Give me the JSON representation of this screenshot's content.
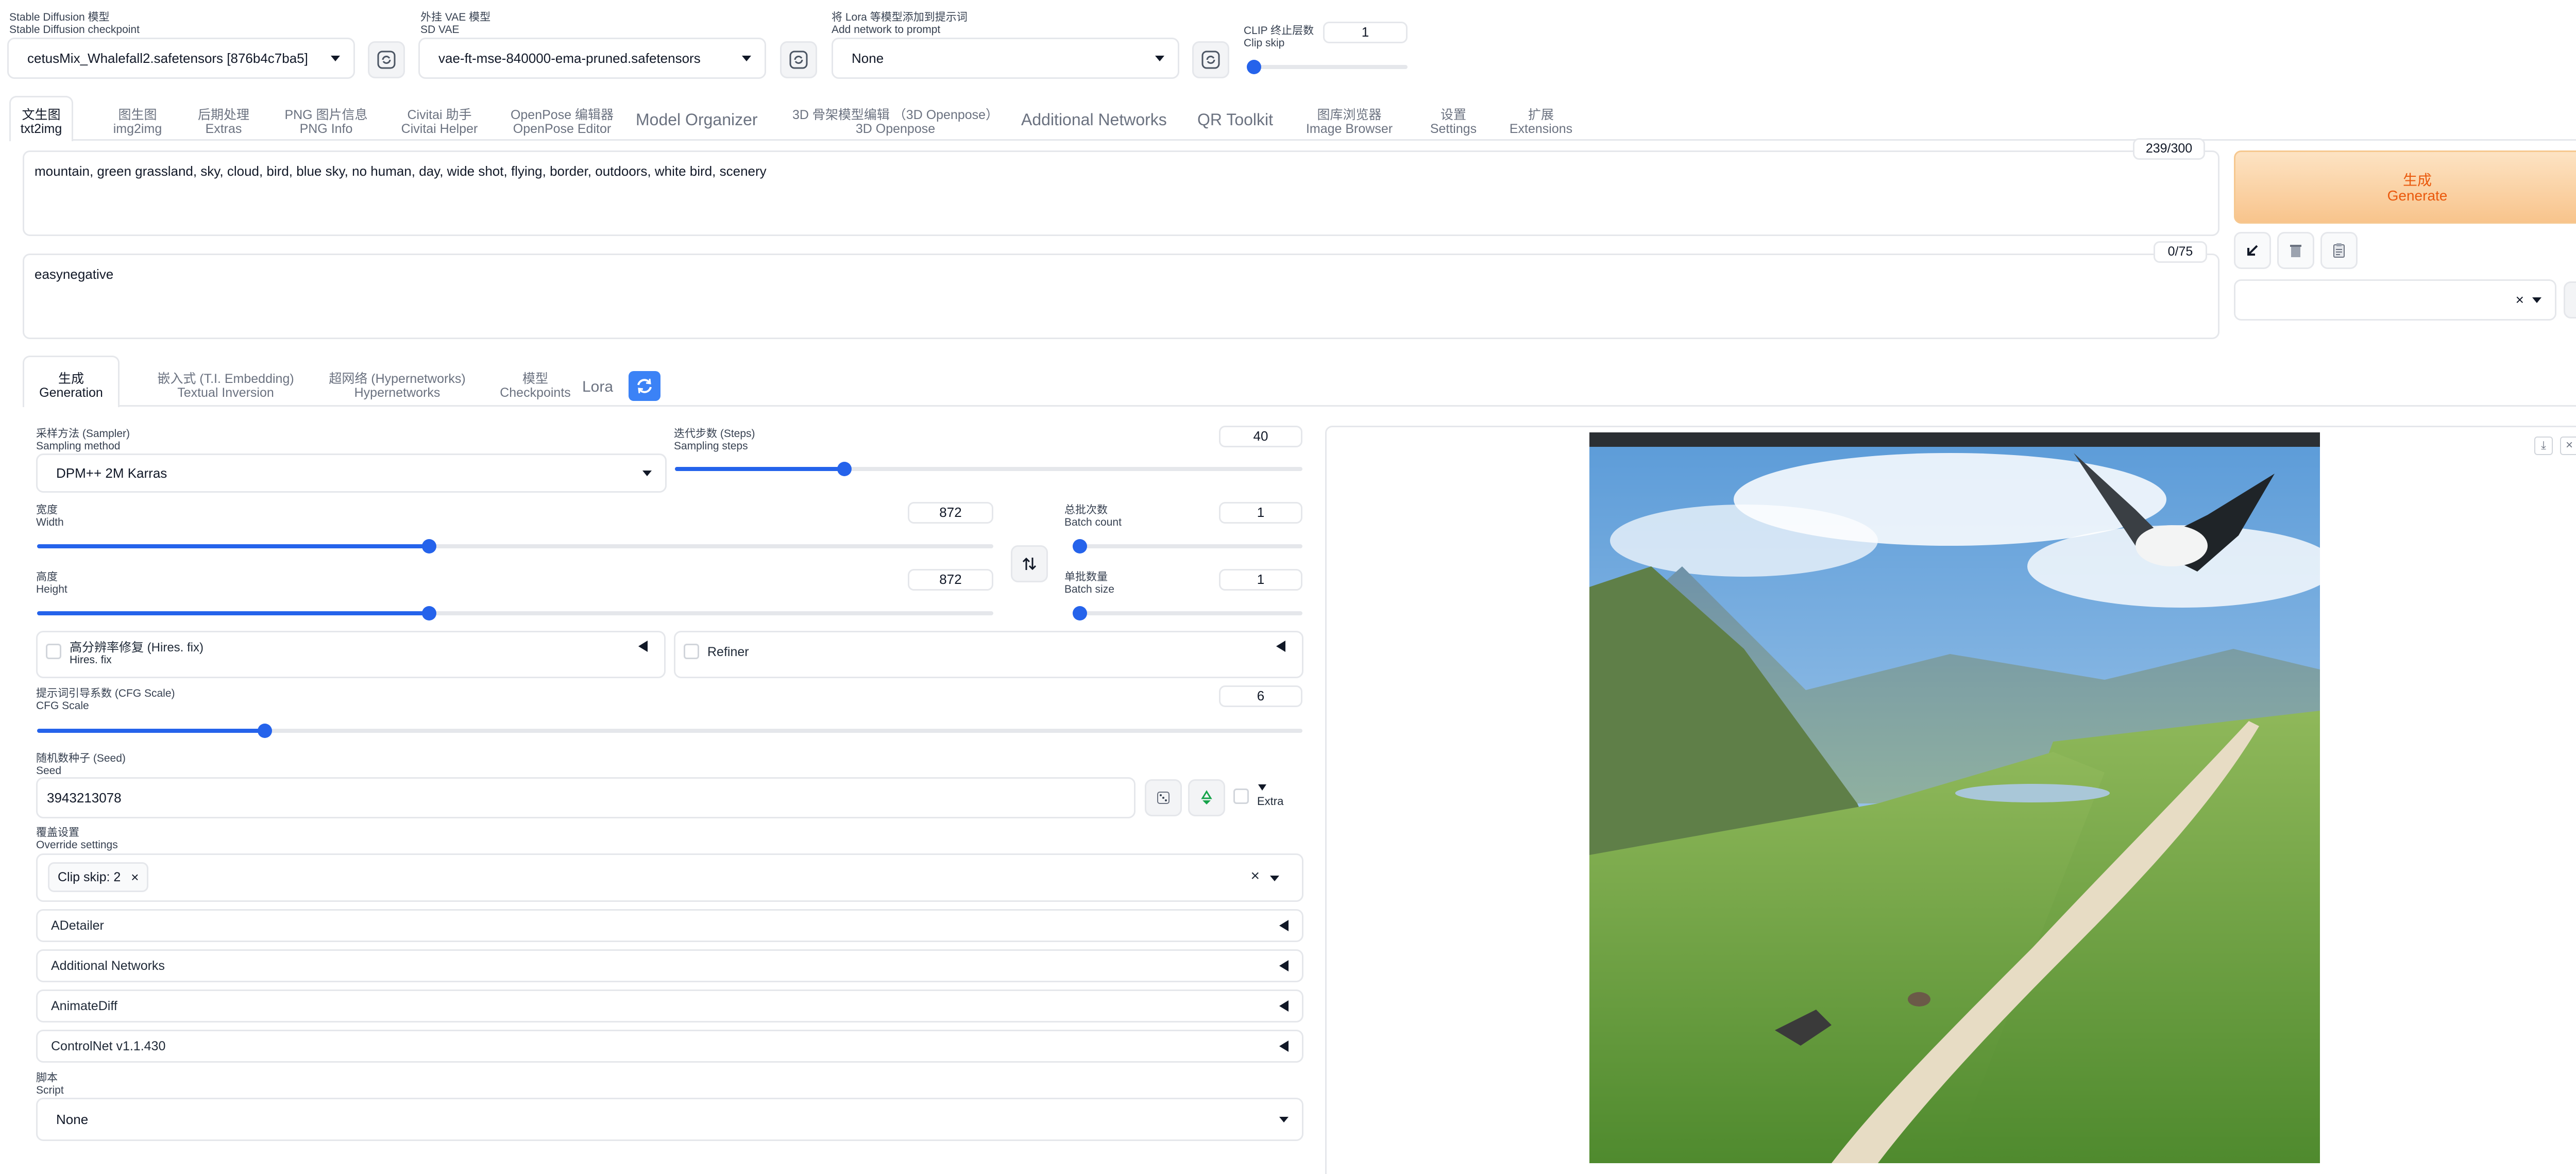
{
  "top": {
    "checkpoint": {
      "label_cn": "Stable Diffusion 模型",
      "label_en": "Stable Diffusion checkpoint",
      "value": "cetusMix_Whalefall2.safetensors [876b4c7ba5]"
    },
    "vae": {
      "label_cn": "外挂 VAE 模型",
      "label_en": "SD VAE",
      "value": "vae-ft-mse-840000-ema-pruned.safetensors"
    },
    "lora": {
      "label_cn": "将 Lora 等模型添加到提示词",
      "label_en": "Add network to prompt",
      "value": "None"
    },
    "clip": {
      "label_cn": "CLIP 终止层数",
      "label_en": "Clip skip",
      "value": "1",
      "fraction": 0
    }
  },
  "tabs": [
    {
      "cn": "文生图",
      "en": "txt2img"
    },
    {
      "cn": "图生图",
      "en": "img2img"
    },
    {
      "cn": "后期处理",
      "en": "Extras"
    },
    {
      "cn": "PNG 图片信息",
      "en": "PNG Info"
    },
    {
      "cn": "Civitai 助手",
      "en": "Civitai Helper"
    },
    {
      "cn": "OpenPose 编辑器",
      "en": "OpenPose Editor"
    },
    {
      "cn": "Model Organizer",
      "en": ""
    },
    {
      "cn": "3D 骨架模型编辑 （3D Openpose）",
      "en": "3D Openpose"
    },
    {
      "cn": "Additional Networks",
      "en": ""
    },
    {
      "cn": "QR Toolkit",
      "en": ""
    },
    {
      "cn": "图库浏览器",
      "en": "Image Browser"
    },
    {
      "cn": "设置",
      "en": "Settings"
    },
    {
      "cn": "扩展",
      "en": "Extensions"
    }
  ],
  "prompt": {
    "text": "mountain, green grassland, sky, cloud, bird, blue sky, no human, day, wide shot, flying, border, outdoors, white bird, scenery",
    "counter": "239/300"
  },
  "negative": {
    "text": "easynegative",
    "counter": "0/75"
  },
  "generate": {
    "cn": "生成",
    "en": "Generate"
  },
  "subtabs": [
    {
      "cn": "生成",
      "en": "Generation"
    },
    {
      "cn": "嵌入式 (T.I. Embedding)",
      "en": "Textual Inversion"
    },
    {
      "cn": "超网络 (Hypernetworks)",
      "en": "Hypernetworks"
    },
    {
      "cn": "模型",
      "en": "Checkpoints"
    },
    {
      "cn": "Lora",
      "en": ""
    }
  ],
  "sampler": {
    "label_cn": "采样方法 (Sampler)",
    "label_en": "Sampling method",
    "value": "DPM++ 2M Karras"
  },
  "steps": {
    "label_cn": "迭代步数 (Steps)",
    "label_en": "Sampling steps",
    "value": "40",
    "fraction": 0.27
  },
  "width": {
    "label_cn": "宽度",
    "label_en": "Width",
    "value": "872",
    "fraction": 0.41
  },
  "height": {
    "label_cn": "高度",
    "label_en": "Height",
    "value": "872",
    "fraction": 0.41
  },
  "batch_count": {
    "label_cn": "总批次数",
    "label_en": "Batch count",
    "value": "1",
    "fraction": 0
  },
  "batch_size": {
    "label_cn": "单批数量",
    "label_en": "Batch size",
    "value": "1",
    "fraction": 0
  },
  "hires": {
    "label_cn": "高分辨率修复 (Hires. fix)",
    "label_en": "Hires. fix"
  },
  "refiner": {
    "label": "Refiner"
  },
  "cfg": {
    "label_cn": "提示词引导系数 (CFG Scale)",
    "label_en": "CFG Scale",
    "value": "6",
    "fraction": 0.18
  },
  "seed": {
    "label_cn": "随机数种子 (Seed)",
    "label_en": "Seed",
    "value": "3943213078",
    "extra": "Extra"
  },
  "override": {
    "label_cn": "覆盖设置",
    "label_en": "Override settings",
    "chip": "Clip skip: 2"
  },
  "accordions": [
    "ADetailer",
    "Additional Networks",
    "AnimateDiff",
    "ControlNet v1.1.430"
  ],
  "script": {
    "label_cn": "脚本",
    "label_en": "Script",
    "value": "None"
  },
  "icons": {
    "clear_x": "×",
    "chip_x": "×",
    "swap": "swap-icon",
    "dice": "dice-icon",
    "recycle": "recycle-icon"
  },
  "colors": {
    "accent": "#2563eb",
    "generate_bg": "#fbd5a8",
    "generate_text": "#ea580c"
  }
}
